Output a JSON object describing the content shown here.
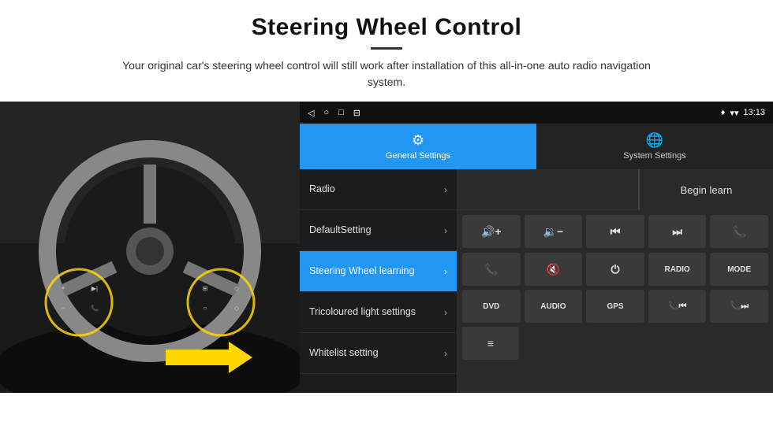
{
  "page": {
    "title": "Steering Wheel Control",
    "subtitle": "Your original car's steering wheel control will still work after installation of this all-in-one auto radio navigation system.",
    "divider": true
  },
  "status_bar": {
    "nav_back": "◁",
    "nav_home": "○",
    "nav_square": "□",
    "nav_menu": "⊟",
    "time": "13:13",
    "signal_icon": "▾",
    "wifi_icon": "▾",
    "gps_icon": "♦"
  },
  "tabs": [
    {
      "id": "general",
      "label": "General Settings",
      "active": true
    },
    {
      "id": "system",
      "label": "System Settings",
      "active": false
    }
  ],
  "menu_items": [
    {
      "id": "radio",
      "label": "Radio",
      "active": false
    },
    {
      "id": "default",
      "label": "DefaultSetting",
      "active": false
    },
    {
      "id": "steering",
      "label": "Steering Wheel learning",
      "active": true
    },
    {
      "id": "tricoloured",
      "label": "Tricoloured light settings",
      "active": false
    },
    {
      "id": "whitelist",
      "label": "Whitelist setting",
      "active": false
    }
  ],
  "begin_learn_label": "Begin learn",
  "control_buttons": {
    "row1": [
      {
        "id": "vol-up",
        "symbol": "🔊+",
        "label": "vol-up"
      },
      {
        "id": "vol-down",
        "symbol": "🔊−",
        "label": "vol-down"
      },
      {
        "id": "prev-track",
        "symbol": "⏮",
        "label": "prev-track"
      },
      {
        "id": "next-track",
        "symbol": "⏭",
        "label": "next-track"
      },
      {
        "id": "phone",
        "symbol": "📞",
        "label": "phone"
      }
    ],
    "row2": [
      {
        "id": "call-answer",
        "symbol": "📞",
        "label": "call-answer"
      },
      {
        "id": "mute",
        "symbol": "🔇",
        "label": "mute"
      },
      {
        "id": "power",
        "symbol": "⏻",
        "label": "power"
      },
      {
        "id": "radio-btn",
        "symbol": "RADIO",
        "label": "radio-btn"
      },
      {
        "id": "mode",
        "symbol": "MODE",
        "label": "mode-btn"
      }
    ],
    "row3": [
      {
        "id": "dvd",
        "symbol": "DVD",
        "label": "dvd-btn"
      },
      {
        "id": "audio",
        "symbol": "AUDIO",
        "label": "audio-btn"
      },
      {
        "id": "gps",
        "symbol": "GPS",
        "label": "gps-btn"
      },
      {
        "id": "phone2",
        "symbol": "📞⏮",
        "label": "phone-prev"
      },
      {
        "id": "phone3",
        "symbol": "📞⏭",
        "label": "phone-next"
      }
    ],
    "row4": [
      {
        "id": "special",
        "symbol": "≡",
        "label": "special-btn"
      }
    ]
  }
}
